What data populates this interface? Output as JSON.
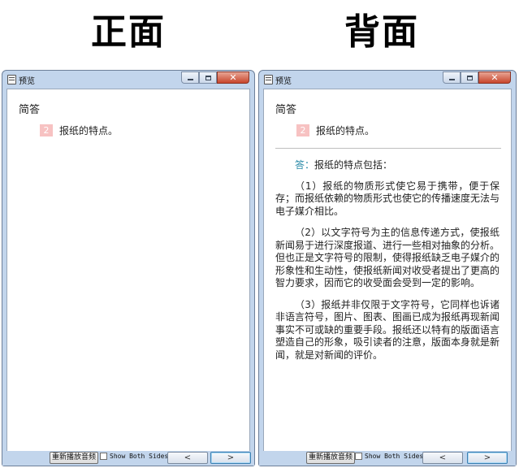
{
  "headings": {
    "front": "正面",
    "back": "背面"
  },
  "window": {
    "title": "预览",
    "minimize_icon": "minimize-icon",
    "maximize_icon": "maximize-icon",
    "close_icon": "close-icon",
    "close_glyph": "✕"
  },
  "card": {
    "section_title": "简答",
    "question_number": "2",
    "question_text": "报纸的特点。"
  },
  "answer": {
    "label": "答：",
    "lead": "报纸的特点包括：",
    "paragraphs": [
      "（1）报纸的物质形式使它易于携带，便于保存；而报纸依赖的物质形式也使它的传播速度无法与电子媒介相比。",
      "（2）以文字符号为主的信息传递方式，使报纸新闻易于进行深度报道、进行一些相对抽象的分析。但也正是文字符号的限制，使得报纸缺乏电子媒介的形象性和生动性，使报纸新闻对收受者提出了更高的智力要求，因而它的收受面会受到一定的影响。",
      "（3）报纸并非仅限于文字符号，它同样也诉诸非语言符号，图片、图表、图画已成为报纸再现新闻事实不可或缺的重要手段。报纸还以特有的版面语言塑造自己的形象，吸引读者的注意，版面本身就是新闻，就是对新闻的评价。"
    ]
  },
  "bottom_bar": {
    "replay_label": "重新播放音频",
    "show_both_label": "Show Both Sides",
    "show_both_checked": false,
    "prev_label": "<",
    "next_label": ">"
  },
  "colors": {
    "window_frame": "#c2d5ec",
    "badge": "#f7c2c2",
    "answer_label": "#2a8aa8",
    "close_button": "#c8452c"
  }
}
